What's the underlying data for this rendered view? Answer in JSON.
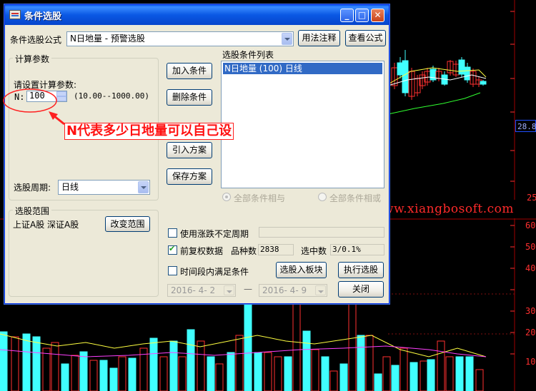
{
  "window": {
    "title": "条件选股",
    "minimize": "_",
    "maximize": "□",
    "close": "✕"
  },
  "formula": {
    "label": "条件选股公式",
    "value": "N日地量  - 预警选股",
    "usage_button": "用法注释",
    "view_button": "查看公式"
  },
  "params": {
    "group_title": "计算参数",
    "prompt": "请设置计算参数:",
    "n_label": "N:",
    "n_value": "100",
    "range": "(10.00--1000.00)"
  },
  "annotation": {
    "text": "N代表多少日地量可以自己设"
  },
  "period": {
    "label": "选股周期:",
    "value": "日线"
  },
  "actions": {
    "add_condition": "加入条件",
    "delete_condition": "删除条件",
    "import_plan": "引入方案",
    "save_plan": "保存方案"
  },
  "conditions": {
    "title": "选股条件列表",
    "items": [
      "N日地量 (100) 日线"
    ],
    "radio_and": "全部条件相与",
    "radio_or": "全部条件相或"
  },
  "scope": {
    "group_title": "选股范围",
    "markets": "上证A股 深证A股",
    "change_button": "改变范围"
  },
  "options": {
    "unfixed_period": "使用涨跌不定周期",
    "forward_adjust": "前复权数据",
    "forward_adjust_checked": true,
    "variety_label": "品种数",
    "variety_value": "2838",
    "selected_label": "选中数",
    "selected_value": "3/0.1%",
    "time_range": "时间段内满足条件",
    "date_from": "2016- 4- 2",
    "date_to": "2016- 4- 9",
    "dash": "—"
  },
  "buttons": {
    "to_sector": "选股入板块",
    "execute": "执行选股",
    "close": "关闭"
  },
  "chart": {
    "price_tag": "28.84",
    "right_axis": [
      "25",
      "60",
      "50",
      "40",
      "30",
      "20",
      "10"
    ],
    "watermark": "翔博软件 www.xiangbosoft.com",
    "colors": {
      "bull": "#ff3030",
      "bear": "#40ffff",
      "ma_white": "#ffffff",
      "ma_yellow": "#ffff40",
      "ma_green": "#30ff30",
      "ma_magenta": "#ff40ff"
    }
  }
}
